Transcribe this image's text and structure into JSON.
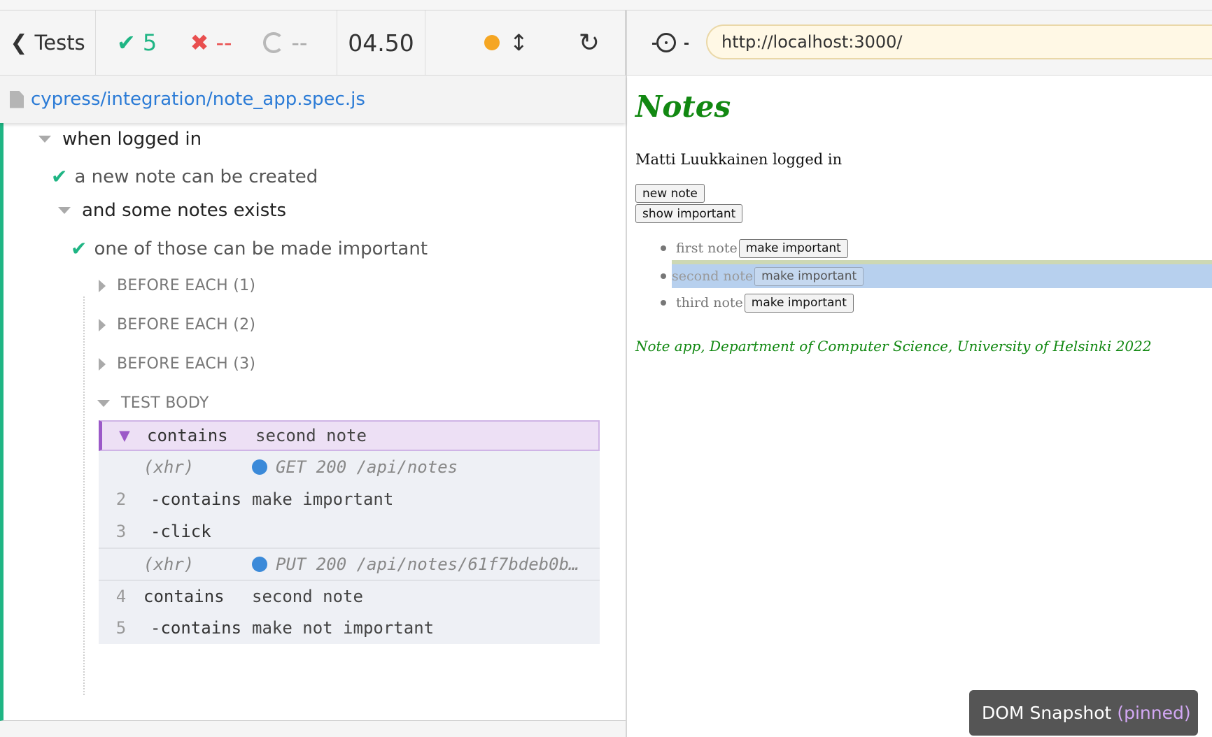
{
  "header": {
    "tests_label": "Tests",
    "passed": "5",
    "failed": "--",
    "pending": "--",
    "duration": "04.50"
  },
  "file": {
    "path": "cypress/integration/note_app.spec.js"
  },
  "runner": {
    "suite1": "when logged in",
    "test1": "a new note can be created",
    "suite2": "and some notes exists",
    "test2": "one of those can be made important",
    "hooks": [
      "BEFORE EACH (1)",
      "BEFORE EACH (2)",
      "BEFORE EACH (3)"
    ],
    "test_body": "TEST BODY",
    "commands": [
      {
        "num": "",
        "name": "contains",
        "msg": "second note"
      },
      {
        "num": "",
        "name": "(xhr)",
        "msg": "GET 200 /api/notes"
      },
      {
        "num": "2",
        "name": "-contains",
        "msg": "make important"
      },
      {
        "num": "3",
        "name": "-click",
        "msg": ""
      },
      {
        "num": "",
        "name": "(xhr)",
        "msg": "PUT 200 /api/notes/61f7bdeb0b…"
      },
      {
        "num": "4",
        "name": "contains",
        "msg": "second note"
      },
      {
        "num": "5",
        "name": "-contains",
        "msg": "make not important"
      }
    ]
  },
  "browser": {
    "url": "http://localhost:3000/"
  },
  "app": {
    "title": "Notes",
    "logged_in": "Matti Luukkainen logged in",
    "new_note": "new note",
    "show_important": "show important",
    "notes": [
      {
        "content": "first note",
        "button": "make important"
      },
      {
        "content": "second note",
        "button": "make important"
      },
      {
        "content": "third note",
        "button": "make important"
      }
    ],
    "footer": "Note app, Department of Computer Science, University of Helsinki 2022"
  },
  "snapshot": {
    "label": "DOM Snapshot",
    "pinned": "(pinned)"
  },
  "colors": {
    "pass": "#1fb584",
    "fail": "#e94f4f",
    "link": "#2b7bd6",
    "app_green": "#118811",
    "pinned_purple": "#9b59c8"
  }
}
